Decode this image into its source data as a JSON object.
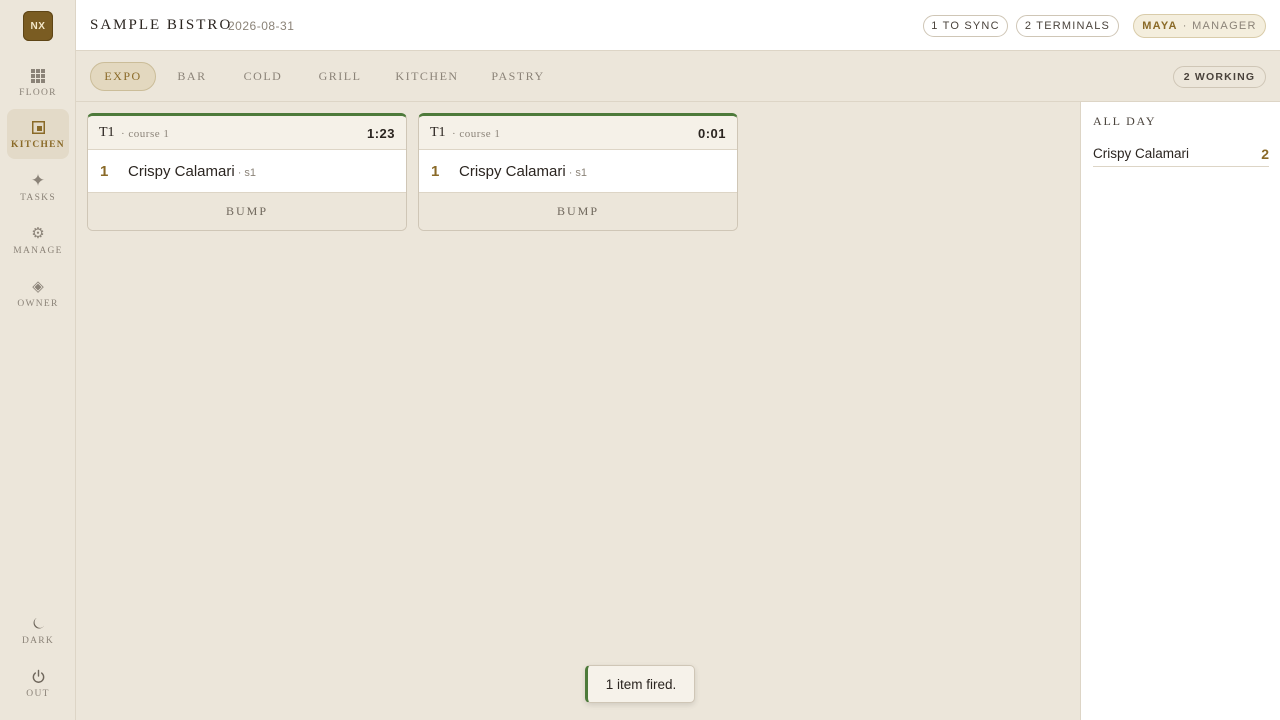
{
  "app": {
    "logo_text": "NX"
  },
  "sidebar": {
    "items": [
      {
        "label": "FLOOR",
        "icon": "grid-icon"
      },
      {
        "label": "KITCHEN",
        "icon": "kitchen-icon"
      },
      {
        "label": "TASKS",
        "icon": "sparkle-icon"
      },
      {
        "label": "MANAGE",
        "icon": "gear-icon"
      },
      {
        "label": "OWNER",
        "icon": "diamond-icon"
      }
    ],
    "active": "KITCHEN",
    "bottom": [
      {
        "label": "DARK",
        "icon": "moon-icon"
      },
      {
        "label": "OUT",
        "icon": "power-icon"
      }
    ]
  },
  "header": {
    "title": "SAMPLE BISTRO",
    "date": "2026-08-31",
    "sync_badge": "1 TO SYNC",
    "terminals_badge": "2 TERMINALS",
    "user_name": "MAYA",
    "user_role": "· MANAGER"
  },
  "stations": {
    "tabs": [
      "EXPO",
      "BAR",
      "COLD",
      "GRILL",
      "KITCHEN",
      "PASTRY"
    ],
    "active": "EXPO",
    "working_badge": "2 WORKING"
  },
  "tickets": [
    {
      "table": "T1",
      "course": "· course 1",
      "timer": "1:23",
      "items": [
        {
          "qty": "1",
          "name": "Crispy Calamari",
          "seat": "· s1"
        }
      ],
      "action": "BUMP"
    },
    {
      "table": "T1",
      "course": "· course 1",
      "timer": "0:01",
      "items": [
        {
          "qty": "1",
          "name": "Crispy Calamari",
          "seat": "· s1"
        }
      ],
      "action": "BUMP"
    }
  ],
  "all_day": {
    "title": "ALL DAY",
    "items": [
      {
        "name": "Crispy Calamari",
        "count": "2"
      }
    ]
  },
  "toast": {
    "message": "1 item fired."
  },
  "colors": {
    "accent": "#8a6a28",
    "fired": "#4d7a3a",
    "background": "#ece6da"
  }
}
